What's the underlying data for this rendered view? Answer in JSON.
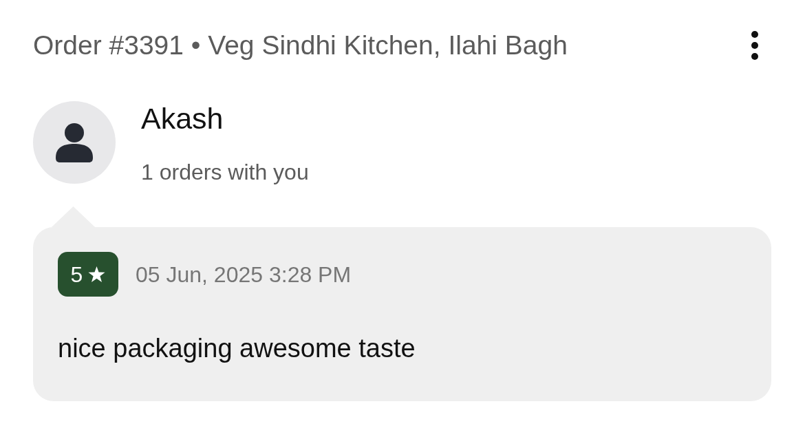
{
  "header": {
    "title": "Order #3391 • Veg Sindhi Kitchen, Ilahi Bagh"
  },
  "customer": {
    "name": "Akash",
    "order_count": "1 orders with you"
  },
  "review": {
    "rating": "5",
    "date": "05 Jun, 2025 3:28 PM",
    "text": "nice packaging awesome taste"
  }
}
